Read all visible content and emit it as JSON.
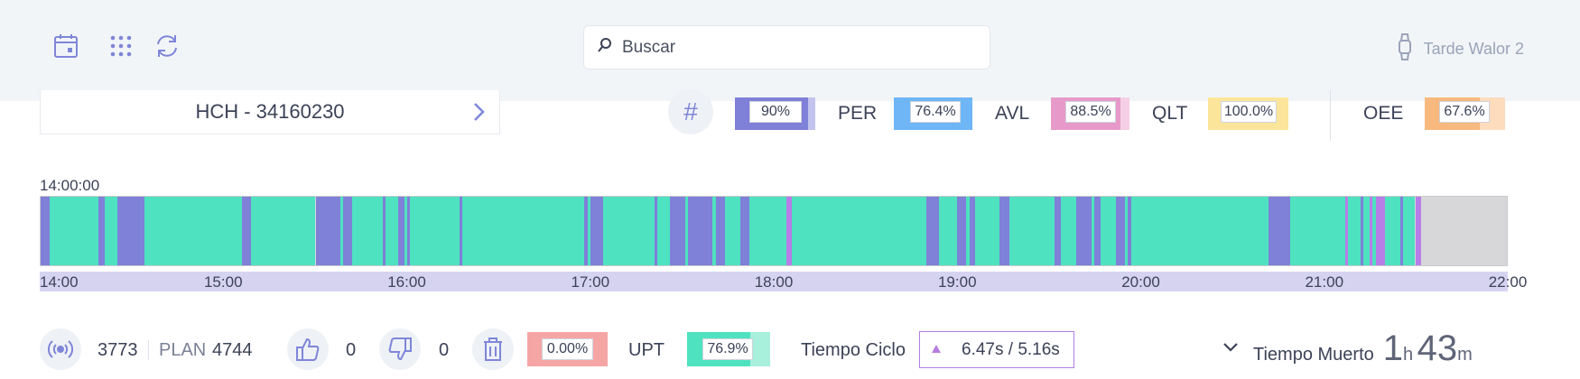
{
  "header": {
    "search_placeholder": "Buscar",
    "user_name": "Tarde Walor 2"
  },
  "order": {
    "code": "HCH - 34160230"
  },
  "metrics": {
    "hash_value": "90%",
    "per_label": "PER",
    "per_value": "76.4%",
    "avl_label": "AVL",
    "avl_value": "88.5%",
    "qlt_label": "QLT",
    "qlt_value": "100.0%",
    "oee_label": "OEE",
    "oee_value": "67.6%",
    "colors": {
      "hash": "#7f80d8",
      "per": "#6eb6f5",
      "avl": "#e79ac9",
      "qlt": "#fbe59a",
      "oee": "#f7b97d"
    }
  },
  "timeline": {
    "start_label": "14:00:00",
    "range_start": "14:00",
    "range_end": "22:00",
    "ticks": [
      "14:00",
      "15:00",
      "16:00",
      "17:00",
      "18:00",
      "19:00",
      "20:00",
      "21:00",
      "22:00"
    ],
    "colors": {
      "running": "#4ee2c0",
      "stop": "#7f80d8",
      "alt_stop": "#b87ee8",
      "no_data": "#d7d7d9"
    },
    "data_end": "21:30",
    "segments": [
      [
        "14:00",
        "14:03",
        "stop"
      ],
      [
        "14:03",
        "14:19",
        "running"
      ],
      [
        "14:19",
        "14:21",
        "stop"
      ],
      [
        "14:21",
        "14:25",
        "running"
      ],
      [
        "14:25",
        "14:34",
        "stop"
      ],
      [
        "14:34",
        "15:06",
        "running"
      ],
      [
        "15:06",
        "15:09",
        "stop"
      ],
      [
        "15:09",
        "15:30",
        "running"
      ],
      [
        "15:30",
        "15:38",
        "stop"
      ],
      [
        "15:38",
        "15:39",
        "running"
      ],
      [
        "15:39",
        "15:42",
        "stop"
      ],
      [
        "15:42",
        "15:52",
        "running"
      ],
      [
        "15:52",
        "15:53",
        "stop"
      ],
      [
        "15:53",
        "15:57",
        "running"
      ],
      [
        "15:57",
        "15:59",
        "stop"
      ],
      [
        "15:59",
        "16:00",
        "running"
      ],
      [
        "16:00",
        "16:01",
        "stop"
      ],
      [
        "16:01",
        "16:17",
        "running"
      ],
      [
        "16:17",
        "16:18",
        "stop"
      ],
      [
        "16:18",
        "16:58",
        "running"
      ],
      [
        "16:58",
        "16:59",
        "stop"
      ],
      [
        "16:59",
        "17:00",
        "running"
      ],
      [
        "17:00",
        "17:04",
        "stop"
      ],
      [
        "17:04",
        "17:21",
        "running"
      ],
      [
        "17:21",
        "17:22",
        "stop"
      ],
      [
        "17:22",
        "17:26",
        "running"
      ],
      [
        "17:26",
        "17:31",
        "stop"
      ],
      [
        "17:31",
        "17:32",
        "running"
      ],
      [
        "17:32",
        "17:40",
        "stop"
      ],
      [
        "17:40",
        "17:41",
        "running"
      ],
      [
        "17:41",
        "17:44",
        "stop"
      ],
      [
        "17:44",
        "17:49",
        "running"
      ],
      [
        "17:49",
        "17:52",
        "stop"
      ],
      [
        "17:52",
        "18:04",
        "running"
      ],
      [
        "18:04",
        "18:06",
        "alt_stop"
      ],
      [
        "18:06",
        "18:50",
        "running"
      ],
      [
        "18:50",
        "18:54",
        "stop"
      ],
      [
        "18:54",
        "19:00",
        "running"
      ],
      [
        "19:00",
        "19:03",
        "stop"
      ],
      [
        "19:03",
        "19:04",
        "running"
      ],
      [
        "19:04",
        "19:06",
        "stop"
      ],
      [
        "19:06",
        "19:14",
        "running"
      ],
      [
        "19:14",
        "19:17",
        "stop"
      ],
      [
        "19:17",
        "19:32",
        "running"
      ],
      [
        "19:32",
        "19:34",
        "stop"
      ],
      [
        "19:34",
        "19:39",
        "running"
      ],
      [
        "19:39",
        "19:44",
        "stop"
      ],
      [
        "19:44",
        "19:45",
        "running"
      ],
      [
        "19:45",
        "19:47",
        "stop"
      ],
      [
        "19:47",
        "19:52",
        "running"
      ],
      [
        "19:52",
        "19:55",
        "stop"
      ],
      [
        "19:55",
        "19:56",
        "running"
      ],
      [
        "19:56",
        "19:57",
        "stop"
      ],
      [
        "19:57",
        "20:42",
        "running"
      ],
      [
        "20:42",
        "20:49",
        "stop"
      ],
      [
        "20:49",
        "21:07",
        "running"
      ],
      [
        "21:07",
        "21:08",
        "alt_stop"
      ],
      [
        "21:08",
        "21:12",
        "running"
      ],
      [
        "21:12",
        "21:13",
        "stop"
      ],
      [
        "21:13",
        "21:15",
        "running"
      ],
      [
        "21:15",
        "21:16",
        "alt_stop"
      ],
      [
        "21:16",
        "21:17",
        "running"
      ],
      [
        "21:17",
        "21:20",
        "alt_stop"
      ],
      [
        "21:20",
        "21:25",
        "running"
      ],
      [
        "21:25",
        "21:26",
        "stop"
      ],
      [
        "21:26",
        "21:30",
        "running"
      ],
      [
        "21:30",
        "21:32",
        "alt_stop"
      ]
    ]
  },
  "stats": {
    "count": "3773",
    "plan_label": "PLAN",
    "plan_value": "4744",
    "likes": "0",
    "dislikes": "0",
    "scrap_pct": "0.00%",
    "upt_label": "UPT",
    "upt_value": "76.9%",
    "cycle_label": "Tiempo Ciclo",
    "cycle_value": "6.47s",
    "cycle_sep": "/",
    "cycle_target": "5.16s",
    "dead_label": "Tiempo Muerto",
    "dead_hours": "1",
    "dead_h_unit": "h",
    "dead_minutes": "43",
    "dead_m_unit": "m"
  }
}
